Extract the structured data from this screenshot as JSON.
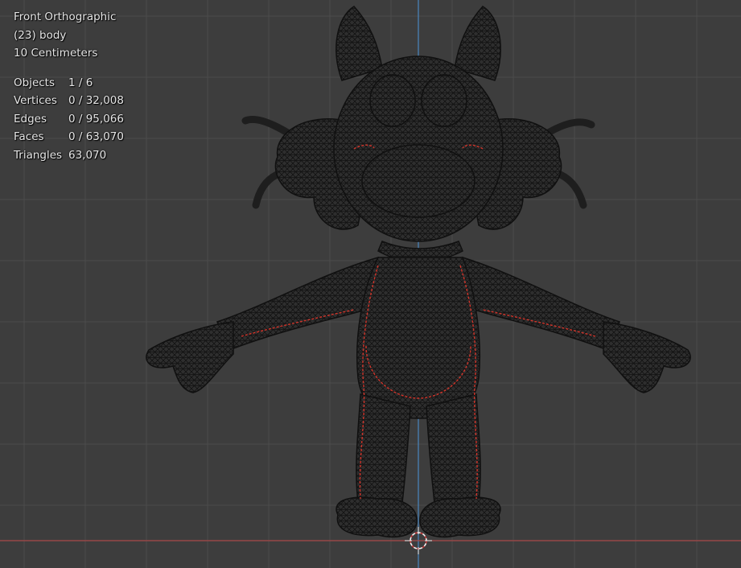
{
  "viewport": {
    "view_name": "Front Orthographic",
    "active_object": "(23) body",
    "grid_scale": "10 Centimeters"
  },
  "stats": [
    {
      "label": "Objects",
      "value": "1 / 6"
    },
    {
      "label": "Vertices",
      "value": "0 / 32,008"
    },
    {
      "label": "Edges",
      "value": "0 / 95,066"
    },
    {
      "label": "Faces",
      "value": "0 / 63,070"
    },
    {
      "label": "Triangles",
      "value": "63,070"
    }
  ],
  "colors": {
    "background": "#3d3d3d",
    "grid_line": "#4b4b4b",
    "z_axis": "#4a87c0",
    "x_axis": "#a84848",
    "mesh_fill": "#2e2e2e",
    "mesh_wire": "#111111",
    "seam": "#d2342a",
    "cursor": "#e8e8e8"
  },
  "icons": {
    "cursor": "3d-cursor-icon"
  }
}
